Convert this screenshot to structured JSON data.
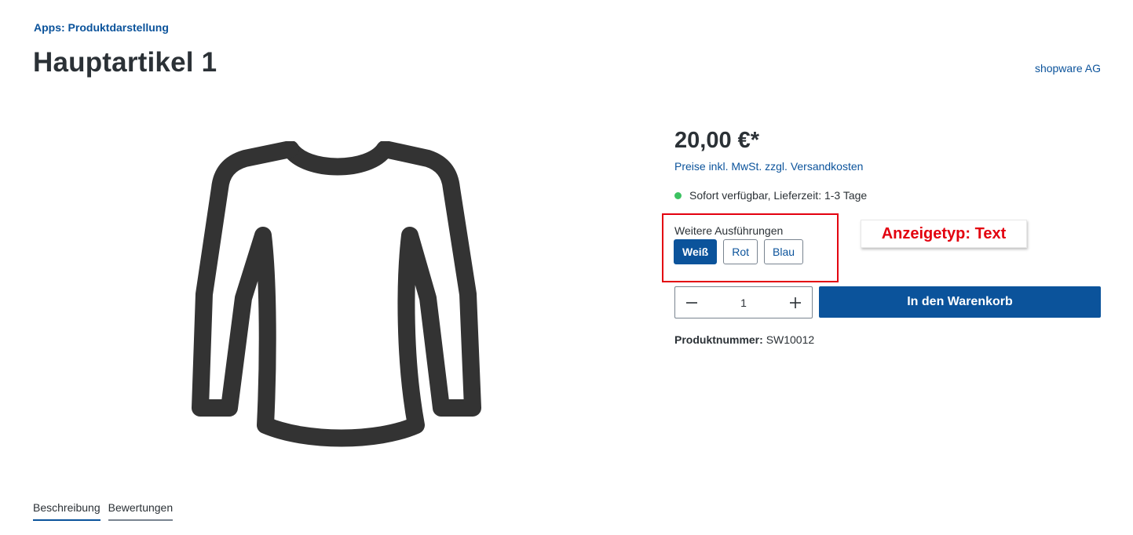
{
  "breadcrumb": "Apps: Produktdarstellung",
  "product": {
    "title": "Hauptartikel 1",
    "manufacturer": "shopware AG",
    "price": "20,00 €*",
    "tax_note": "Preise inkl. MwSt. zzgl. Versandkosten",
    "delivery": "Sofort verfügbar, Lieferzeit: 1-3 Tage",
    "product_number_label": "Produktnummer:",
    "product_number": "SW10012",
    "image_icon": "long-sleeve-shirt-icon"
  },
  "variants": {
    "label": "Weitere Ausführungen",
    "options": [
      "Weiß",
      "Rot",
      "Blau"
    ],
    "selected": "Weiß"
  },
  "annotation": "Anzeigetyp: Text",
  "buy": {
    "quantity": "1",
    "add_to_cart": "In den Warenkorb"
  },
  "tabs": [
    "Beschreibung",
    "Bewertungen"
  ],
  "colors": {
    "primary": "#0b539b",
    "text": "#2b3136",
    "highlight_red": "#e3000f",
    "available_green": "#3cc261"
  }
}
